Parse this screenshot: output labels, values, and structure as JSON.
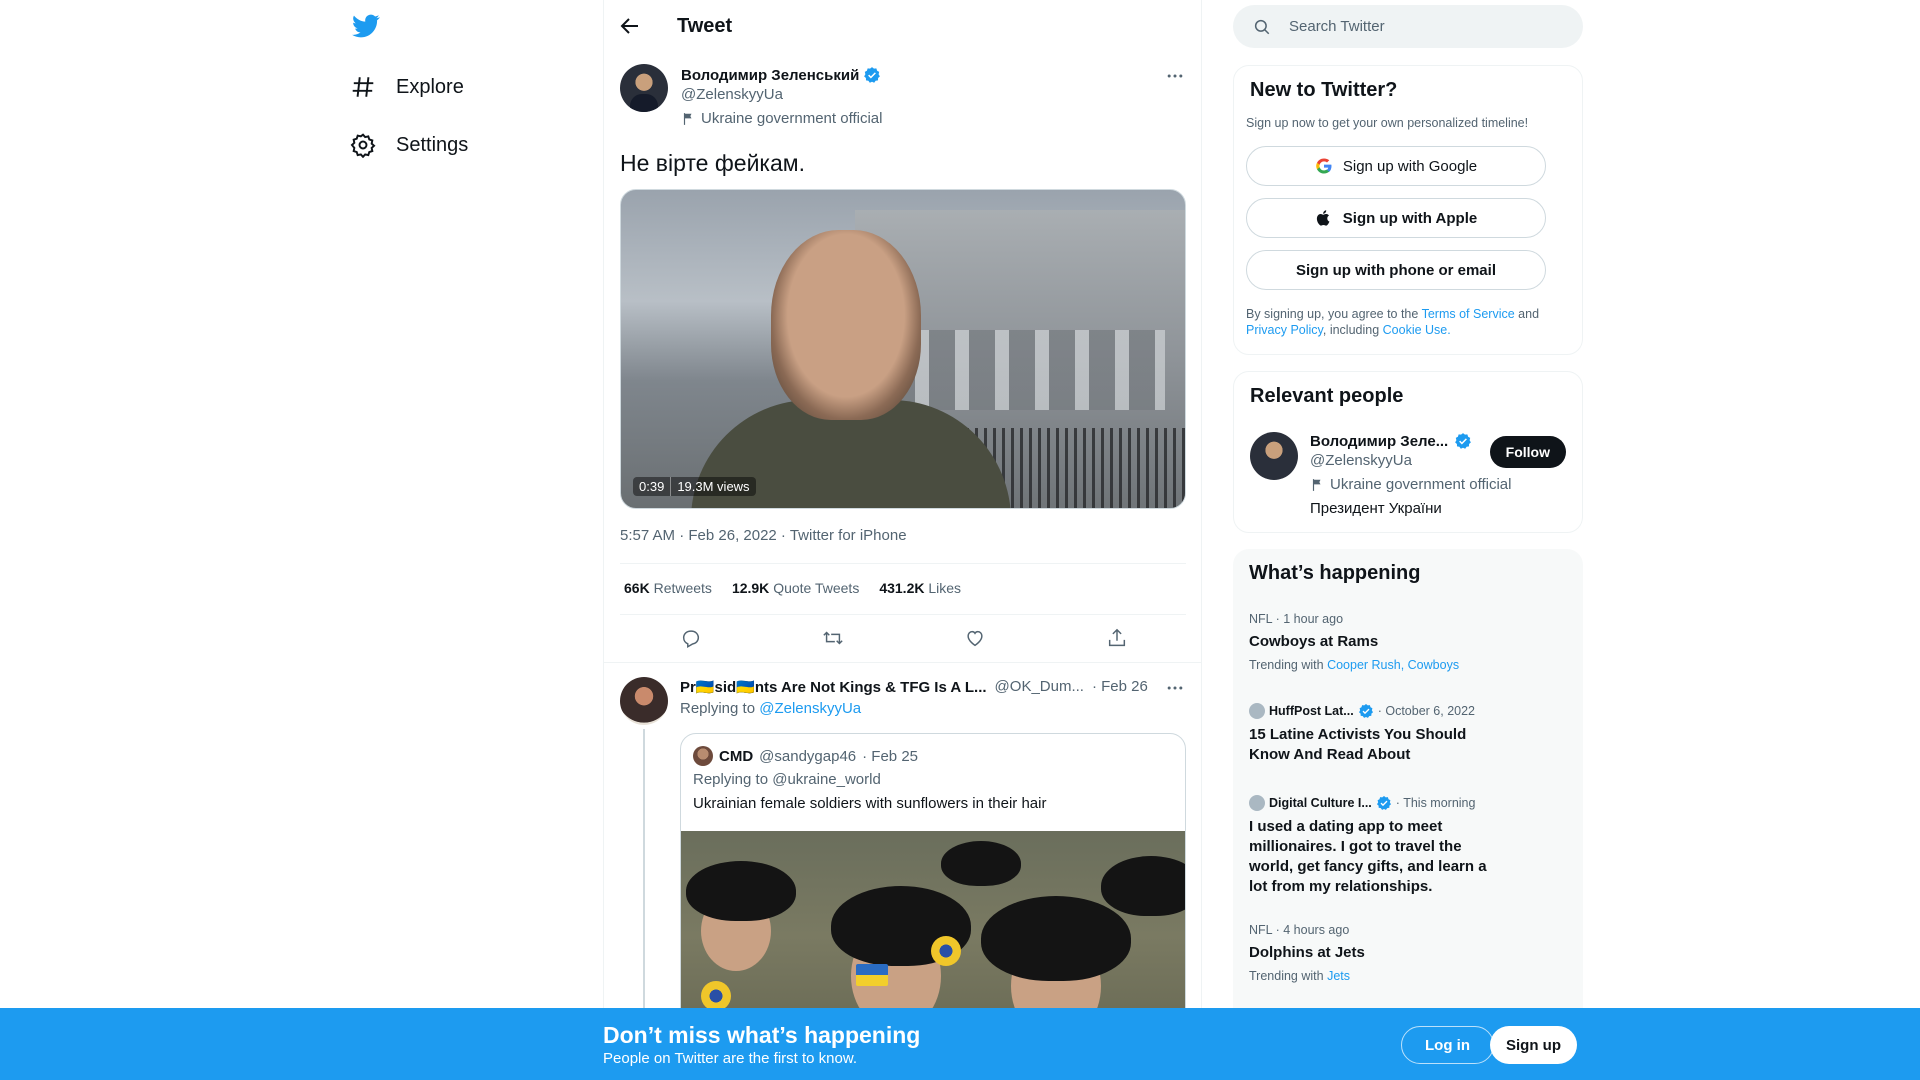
{
  "nav": {
    "logo": "twitter-bird-icon",
    "items": [
      {
        "label": "Explore",
        "icon": "hashtag-icon"
      },
      {
        "label": "Settings",
        "icon": "gear-icon"
      }
    ]
  },
  "header": {
    "title": "Tweet"
  },
  "tweet": {
    "author_name": "Володимир Зеленський",
    "author_handle": "@ZelenskyyUa",
    "author_label": "Ukraine government official",
    "text": "Не вірте фейкам.",
    "video_duration": "0:39",
    "video_views": "19.3M views",
    "meta": "5:57 AM · Feb 26, 2022 · Twitter for iPhone",
    "stats": {
      "retweets": "66K",
      "retweets_label": "Retweets",
      "quotes": "12.9K",
      "quotes_label": "Quote Tweets",
      "likes": "431.2K",
      "likes_label": "Likes"
    }
  },
  "reply": {
    "name": "Pr🇺🇦sid🇺🇦nts Are Not Kings & TFG Is A L...",
    "handle": "@OK_Dum...",
    "date": "· Feb 26",
    "replying_prefix": "Replying to",
    "replying_to": "@ZelenskyyUa",
    "quote": {
      "name": "CMD",
      "handle": "@sandygap46",
      "date": "· Feb 25",
      "replying": "Replying to @ukraine_world",
      "text": "Ukrainian female soldiers with sunflowers in their hair"
    }
  },
  "search": {
    "placeholder": "Search Twitter"
  },
  "new_to_twitter": {
    "title": "New to Twitter?",
    "subtitle": "Sign up now to get your own personalized timeline!",
    "google": "Sign up with Google",
    "apple": "Sign up with Apple",
    "phone": "Sign up with phone or email",
    "terms_1": "By signing up, you agree to the ",
    "terms_link": "Terms of Service",
    "terms_2": " and ",
    "privacy_link": "Privacy Policy",
    "terms_3": ", including ",
    "cookie_link": "Cookie Use."
  },
  "relevant": {
    "title": "Relevant people",
    "name": "Володимир Зеле...",
    "handle": "@ZelenskyyUa",
    "label": "Ukraine government official",
    "bio": "Президент України",
    "follow": "Follow"
  },
  "trends": {
    "title": "What’s happening",
    "items": [
      {
        "meta": "NFL · 1 hour ago",
        "title": "Cowboys at Rams",
        "with": "Trending with",
        "links": "Cooper Rush, Cowboys"
      },
      {
        "source": "HuffPost Lat...",
        "time": "· October 6, 2022",
        "title": "15 Latine Activists You Should Know And Read About"
      },
      {
        "source": "Digital Culture I...",
        "time": "· This morning",
        "title": "I used a dating app to meet millionaires. I got to travel the world, get fancy gifts, and learn a lot from my relationships."
      },
      {
        "meta": "NFL · 4 hours ago",
        "title": "Dolphins at Jets",
        "with": "Trending with",
        "links": "Jets"
      }
    ]
  },
  "bottom": {
    "title": "Don’t miss what’s happening",
    "subtitle": "People on Twitter are the first to know.",
    "login": "Log in",
    "signup": "Sign up"
  },
  "colors": {
    "accent": "#1d9bf0",
    "text": "#0f1419",
    "muted": "#536471"
  }
}
